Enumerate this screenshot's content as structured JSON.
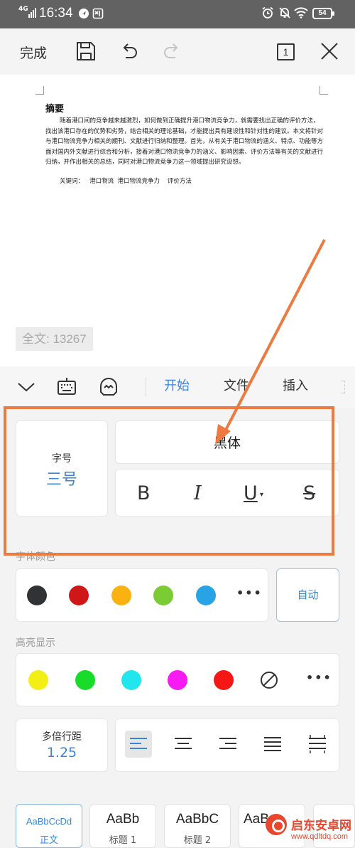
{
  "status_bar": {
    "network": "4G",
    "time": "16:34",
    "battery": "54"
  },
  "toolbar": {
    "done_label": "完成",
    "page_count": "1"
  },
  "document": {
    "heading": "摘要",
    "abstract": "随着港口间的竞争越来越激烈，如何做到正确提升港口物流竞争力，就需要找出正确的评价方法，找出该港口存在的优势和劣势，结合相关的理论基础，才能提出具有建设性和针对性的建议。本文将针对与港口物流竞争力相关的期刊、文献进行归纳和整理。首先，从有关于港口物流的涵义、特点、功能等方面对国内外文献进行综合和分析，接着对港口物流竞争力的涵义、影响因素、评价方法等有关的文献进行归纳，并作出相关的总结，同时对港口物流竞争力这一领域提出研究设想。",
    "keywords": "关键词：   港口物流  港口物流竞争力    评价方法",
    "word_count": "全文: 13267"
  },
  "tabs": [
    {
      "label": "开始",
      "active": true
    },
    {
      "label": "文件",
      "active": false
    },
    {
      "label": "插入",
      "active": false
    }
  ],
  "font": {
    "size_label": "字号",
    "size_value": "三号",
    "name": "黑体",
    "format_buttons": [
      "B",
      "I",
      "U",
      "S"
    ]
  },
  "font_color": {
    "label": "字体颜色",
    "colors": [
      "#303235",
      "#d01718",
      "#fbb10f",
      "#7bcb35",
      "#27a3e6"
    ],
    "auto_label": "自动"
  },
  "highlight": {
    "label": "高亮显示",
    "colors": [
      "#f3ee15",
      "#19dc2a",
      "#22e5ee",
      "#f71af2",
      "#f51616"
    ]
  },
  "line_spacing": {
    "label": "多倍行距",
    "value": "1.25",
    "selected_alignment": "left"
  },
  "styles": [
    {
      "preview": "AaBbCcDd",
      "name": "正文"
    },
    {
      "preview": "AaBb",
      "name": "标题 1"
    },
    {
      "preview": "AaBbC",
      "name": "标题 2"
    },
    {
      "preview": "AaB",
      "name": ""
    }
  ],
  "watermark": {
    "name": "启东安卓网",
    "url": "www.qdltdq.com"
  },
  "accent_colors": {
    "blue": "#3a86d6",
    "annotation_orange": "#ed7a40"
  }
}
